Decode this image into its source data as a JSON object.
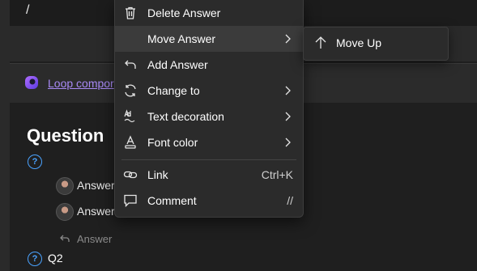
{
  "document": {
    "slash_text": "/",
    "loop_link": "Loop compor",
    "question_title": "Question",
    "answers": [
      "Answer",
      "Answer"
    ],
    "answer_placeholder": "Answer",
    "question2": "Q2",
    "help_glyph": "?"
  },
  "context_menu": {
    "items": [
      {
        "label": "Delete Answer",
        "icon": "trash-icon"
      },
      {
        "label": "Move Answer",
        "icon": "none",
        "has_submenu": true,
        "highlighted": true
      },
      {
        "label": "Add Answer",
        "icon": "reply-icon"
      },
      {
        "label": "Change to",
        "icon": "refresh-icon",
        "has_submenu": true
      },
      {
        "label": "Text decoration",
        "icon": "text-decoration-icon",
        "has_submenu": true
      },
      {
        "label": "Font color",
        "icon": "font-color-icon",
        "has_submenu": true
      },
      {
        "label": "Link",
        "icon": "link-icon",
        "shortcut": "Ctrl+K"
      },
      {
        "label": "Comment",
        "icon": "comment-icon",
        "shortcut": "//"
      }
    ]
  },
  "submenu": {
    "items": [
      {
        "label": "Move Up",
        "icon": "arrow-up-icon"
      }
    ]
  },
  "colors": {
    "background": "#1f1f1f",
    "menu": "#2b2b2b",
    "hover": "#3b3b3b",
    "link": "#a889f5",
    "help": "#4aa3ff"
  }
}
